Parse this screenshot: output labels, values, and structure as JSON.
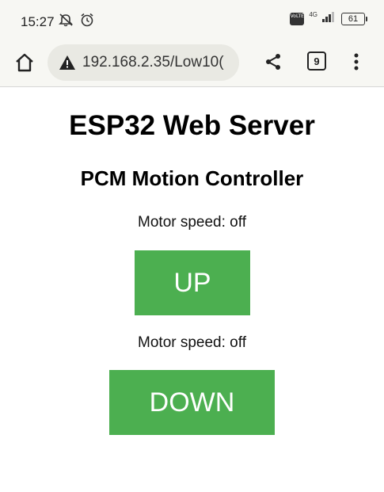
{
  "status_bar": {
    "time": "15:27",
    "network": "4G",
    "volte": "VoLTE",
    "battery": "61"
  },
  "browser": {
    "url": "192.168.2.35/Low10(",
    "tab_count": "9"
  },
  "page": {
    "title": "ESP32 Web Server",
    "subtitle": "PCM Motion Controller",
    "status_1": "Motor speed: off",
    "up_button": "UP",
    "status_2": "Motor speed: off",
    "down_button": "DOWN"
  },
  "colors": {
    "button_bg": "#4caf50",
    "button_text": "#ffffff",
    "toolbar_bg": "#f7f7f3",
    "url_bar_bg": "#e9e9e3"
  },
  "icons": [
    "mute-icon",
    "alarm-icon",
    "volte-icon",
    "signal-icon",
    "battery-icon",
    "home-icon",
    "warning-icon",
    "share-icon",
    "tabs-icon",
    "more-icon"
  ]
}
